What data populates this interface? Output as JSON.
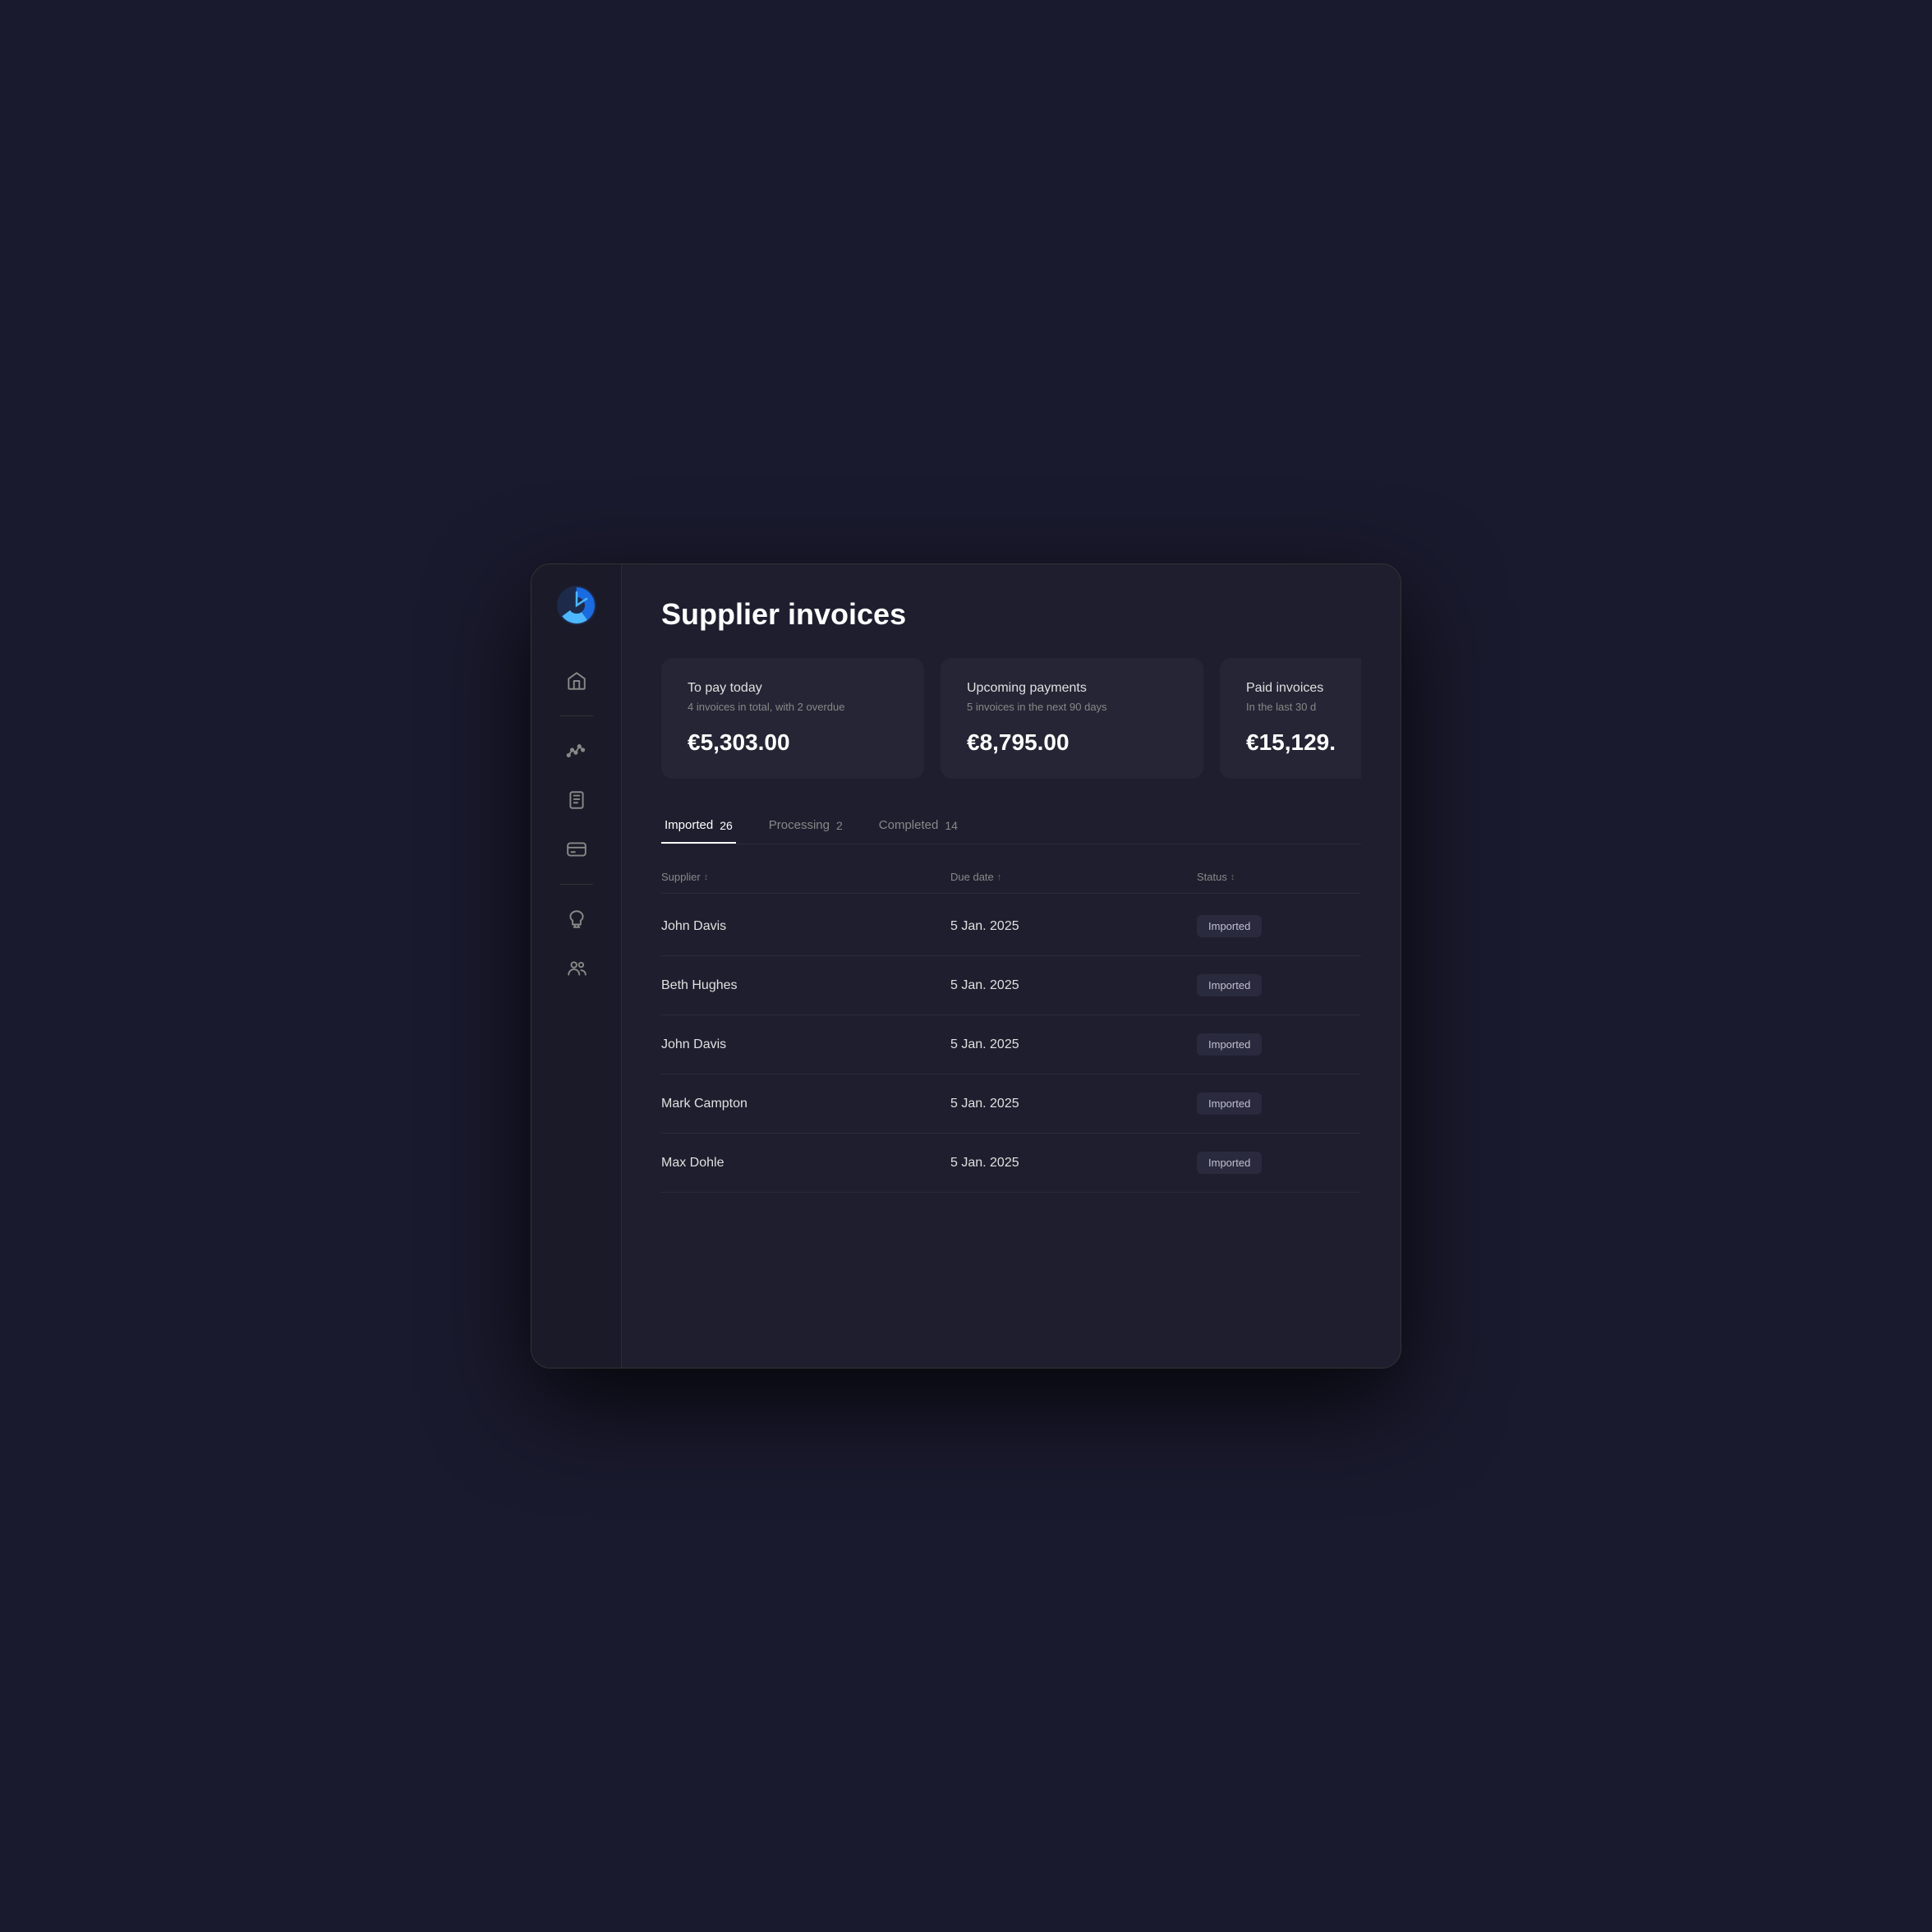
{
  "page": {
    "title": "Supplier invoices"
  },
  "sidebar": {
    "logo_alt": "app-logo",
    "items": [
      {
        "name": "home",
        "icon": "home-icon"
      },
      {
        "name": "analytics",
        "icon": "analytics-icon"
      },
      {
        "name": "documents",
        "icon": "documents-icon"
      },
      {
        "name": "cards",
        "icon": "cards-icon"
      },
      {
        "name": "savings",
        "icon": "savings-icon"
      },
      {
        "name": "team",
        "icon": "team-icon"
      }
    ]
  },
  "cards": [
    {
      "title": "To pay today",
      "subtitle": "4 invoices in total, with 2 overdue",
      "amount": "€5,303.00"
    },
    {
      "title": "Upcoming payments",
      "subtitle": "5 invoices in the next 90 days",
      "amount": "€8,795.00"
    },
    {
      "title": "Paid invoices",
      "subtitle": "In the last 30 d",
      "amount": "€15,129."
    }
  ],
  "tabs": [
    {
      "label": "Imported",
      "badge": "26",
      "active": true
    },
    {
      "label": "Processing",
      "badge": "2",
      "active": false
    },
    {
      "label": "Completed",
      "badge": "14",
      "active": false
    }
  ],
  "table": {
    "headers": [
      {
        "label": "Supplier",
        "sort": "↕"
      },
      {
        "label": "Due date",
        "sort": "↑"
      },
      {
        "label": "Status",
        "sort": "↕"
      }
    ],
    "rows": [
      {
        "supplier": "John Davis",
        "due_date": "5 Jan. 2025",
        "status": "Imported"
      },
      {
        "supplier": "Beth Hughes",
        "due_date": "5 Jan. 2025",
        "status": "Imported"
      },
      {
        "supplier": "John Davis",
        "due_date": "5 Jan. 2025",
        "status": "Imported"
      },
      {
        "supplier": "Mark Campton",
        "due_date": "5 Jan. 2025",
        "status": "Imported"
      },
      {
        "supplier": "Max Dohle",
        "due_date": "5 Jan. 2025",
        "status": "Imported"
      }
    ]
  }
}
